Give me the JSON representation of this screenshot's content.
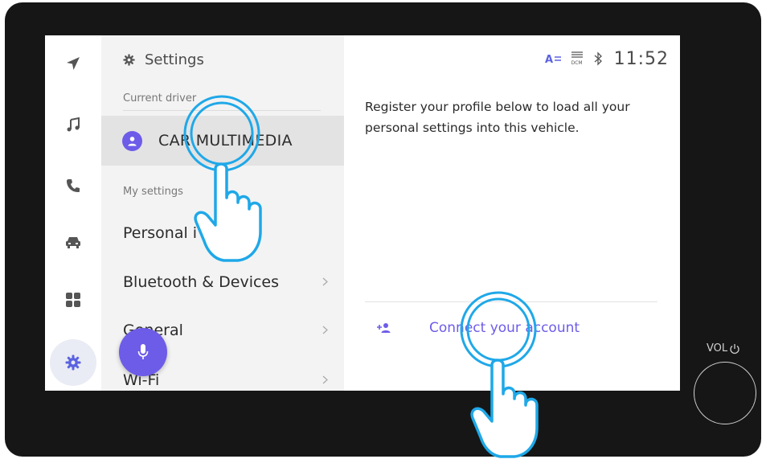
{
  "rail": {
    "items": [
      {
        "icon": "navigation-arrow-icon",
        "active": false
      },
      {
        "icon": "music-note-icon",
        "active": false
      },
      {
        "icon": "phone-icon",
        "active": false
      },
      {
        "icon": "car-icon",
        "active": false
      },
      {
        "icon": "apps-grid-icon",
        "active": false
      },
      {
        "icon": "gear-icon",
        "active": true
      }
    ]
  },
  "settings": {
    "title": "Settings",
    "current_driver_label": "Current driver",
    "driver_name": "CAR MULTIMEDIA",
    "my_settings_label": "My settings",
    "items": [
      {
        "label": "Personal i"
      },
      {
        "label": "Bluetooth & Devices"
      },
      {
        "label": "General"
      },
      {
        "label": "Wi-Fi"
      }
    ]
  },
  "status": {
    "time": "11:52",
    "dcm_label": "DCM"
  },
  "detail": {
    "description": "Register your profile below to load all your personal settings into this vehicle.",
    "connect_label": "Connect your account"
  },
  "hardware": {
    "vol_label": "VOL"
  },
  "colors": {
    "accent": "#6d5ce8",
    "tap_indicator": "#1fa8e8"
  }
}
